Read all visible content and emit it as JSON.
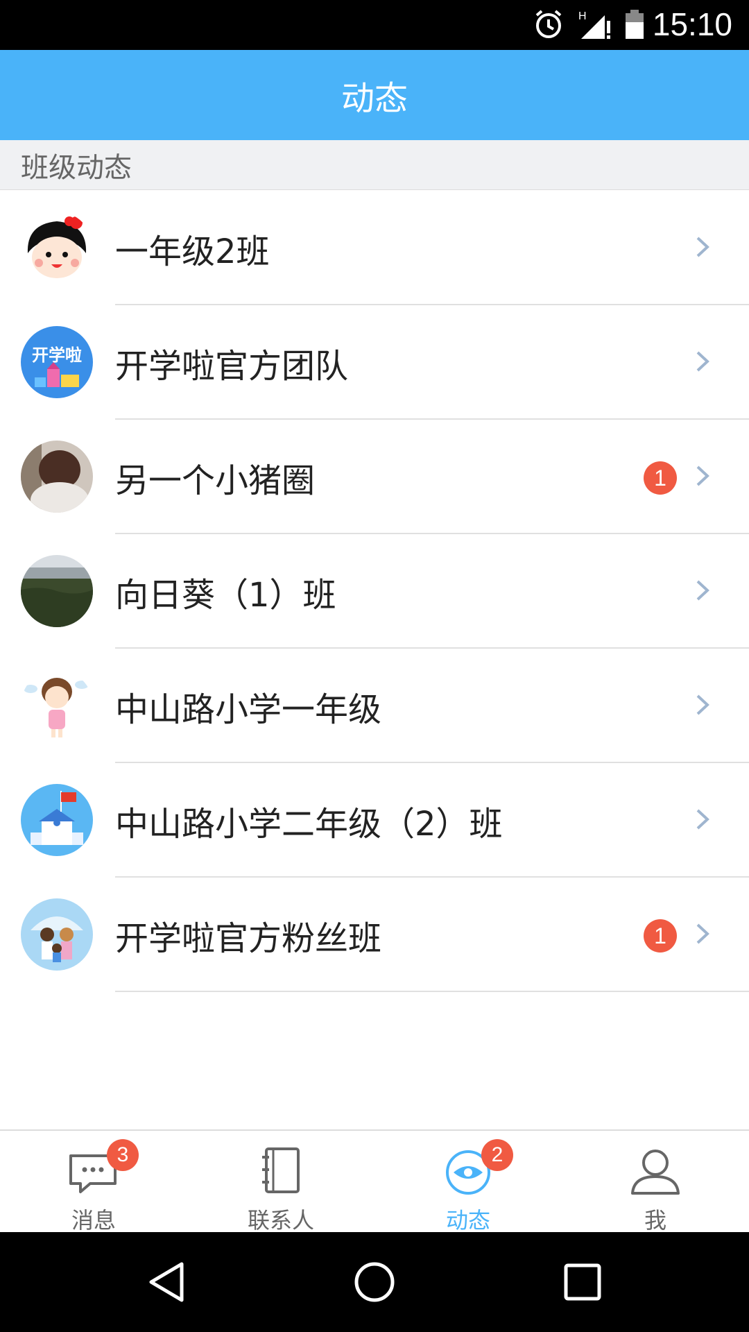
{
  "status_bar": {
    "time": "15:10",
    "icons": [
      "alarm-icon",
      "signal-icon",
      "battery-icon"
    ]
  },
  "app_bar": {
    "title": "动态"
  },
  "section": {
    "title": "班级动态"
  },
  "list": [
    {
      "name": "一年级2班",
      "badge": ""
    },
    {
      "name": "开学啦官方团队",
      "badge": ""
    },
    {
      "name": "另一个小猪圈",
      "badge": "1"
    },
    {
      "name": "向日葵（1）班",
      "badge": ""
    },
    {
      "name": "中山路小学一年级",
      "badge": ""
    },
    {
      "name": "中山路小学二年级（2）班",
      "badge": ""
    },
    {
      "name": "开学啦官方粉丝班",
      "badge": "1"
    }
  ],
  "tabs": [
    {
      "label": "消息",
      "badge": "3",
      "icon": "message-icon"
    },
    {
      "label": "联系人",
      "badge": "",
      "icon": "contacts-icon"
    },
    {
      "label": "动态",
      "badge": "2",
      "icon": "moments-icon",
      "active": true
    },
    {
      "label": "我",
      "badge": "",
      "icon": "profile-icon"
    }
  ],
  "colors": {
    "accent": "#4ab3f9",
    "badge": "#f05a42"
  }
}
